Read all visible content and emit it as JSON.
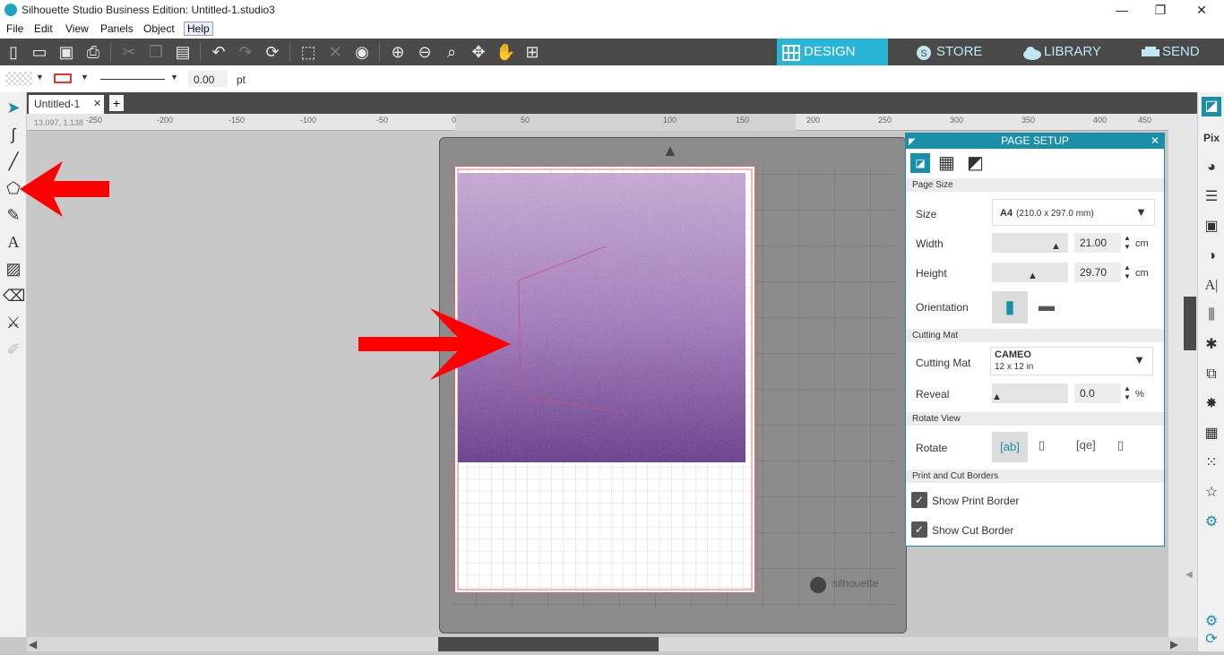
{
  "window": {
    "title": "Silhouette Studio Business Edition: Untitled-1.studio3"
  },
  "menu": [
    "File",
    "Edit",
    "View",
    "Panels",
    "Object",
    "Help"
  ],
  "nav_tabs": {
    "design": "DESIGN",
    "store": "STORE",
    "library": "LIBRARY",
    "send": "SEND"
  },
  "line_options": {
    "width_value": "0.00",
    "unit": "pt"
  },
  "doc_tab": {
    "name": "Untitled-1"
  },
  "ruler": {
    "coords": "13.097, 1.138",
    "ticks": [
      "-250",
      "-200",
      "-150",
      "-100",
      "-50",
      "0",
      "50",
      "100",
      "150",
      "200",
      "250",
      "300",
      "350",
      "400",
      "450"
    ]
  },
  "mat": {
    "brand": "silhouette"
  },
  "page_setup": {
    "title": "PAGE SETUP",
    "sections": {
      "page_size": "Page Size",
      "cutting_mat": "Cutting Mat",
      "rotate_view": "Rotate View",
      "borders": "Print and Cut Borders"
    },
    "size_label": "Size",
    "size_value_main": "A4",
    "size_value_detail": "(210.0 x 297.0 mm)",
    "width_label": "Width",
    "width_value": "21.00",
    "height_label": "Height",
    "height_value": "29.70",
    "unit": "cm",
    "orientation_label": "Orientation",
    "cutting_mat_label": "Cutting Mat",
    "cutting_mat_value": "CAMEO",
    "cutting_mat_detail": "12 x 12 in",
    "reveal_label": "Reveal",
    "reveal_value": "0.0",
    "reveal_unit": "%",
    "rotate_label": "Rotate",
    "show_print_border": "Show Print Border",
    "show_cut_border": "Show Cut Border",
    "show_print_border_checked": true,
    "show_cut_border_checked": true
  },
  "colors": {
    "accent": "#29b6d6",
    "panel_header": "#1b8ea8",
    "toolbar": "#4a4a4a",
    "annotation_arrow": "#ff0000"
  }
}
